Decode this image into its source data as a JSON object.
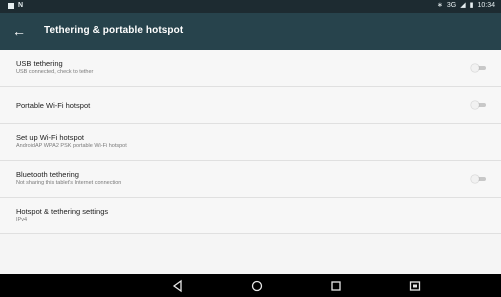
{
  "status_bar": {
    "network_label": "3G",
    "time": "10:34"
  },
  "app_bar": {
    "title": "Tethering & portable hotspot"
  },
  "settings": [
    {
      "title": "USB tethering",
      "subtitle": "USB connected, check to tether",
      "toggle": "off"
    },
    {
      "title": "Portable Wi-Fi hotspot",
      "subtitle": "",
      "toggle": "off"
    },
    {
      "title": "Set up Wi-Fi hotspot",
      "subtitle": "AndroidAP WPA2 PSK portable Wi-Fi hotspot",
      "toggle": "none"
    },
    {
      "title": "Bluetooth tethering",
      "subtitle": "Not sharing this tablet's Internet connection",
      "toggle": "off"
    },
    {
      "title": "Hotspot & tethering settings",
      "subtitle": "IPv4",
      "toggle": "none"
    }
  ],
  "colors": {
    "app_bar": "#27434c",
    "status_bar": "#1d2b31",
    "background": "#f5f5f5"
  }
}
